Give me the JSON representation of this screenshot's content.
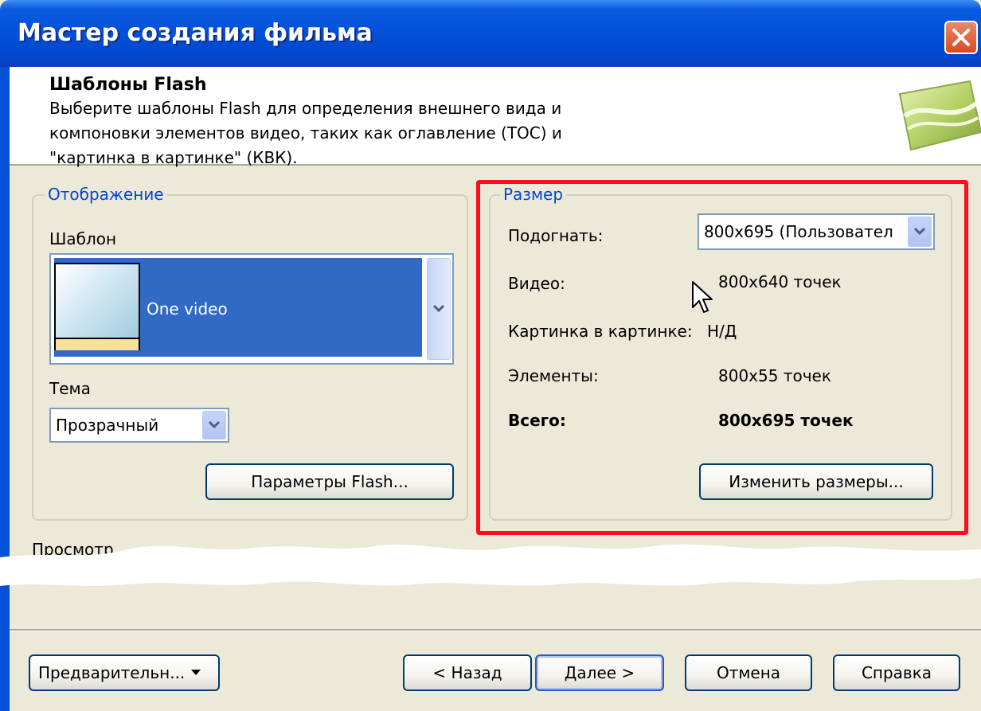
{
  "window": {
    "title": "Мастер создания фильма"
  },
  "header": {
    "title": "Шаблоны Flash",
    "description": "Выберите шаблоны Flash для определения внешнего вида и\nкомпоновки элементов видео, таких как оглавление (TOC) и\n\"картинка в картинке\" (КВК)."
  },
  "display_group": {
    "legend": "Отображение",
    "template_label": "Шаблон",
    "template_selected": "One video",
    "theme_label": "Тема",
    "theme_value": "Прозрачный",
    "flash_params_button": "Параметры Flash..."
  },
  "size_group": {
    "legend": "Размер",
    "fit_label": "Подогнать:",
    "fit_value": "800x695 (Пользовател",
    "video_label": "Видео:",
    "video_value": "800x640 точек",
    "pip_label": "Картинка в картинке:",
    "pip_value": "Н/Д",
    "elements_label": "Элементы:",
    "elements_value": "800x55 точек",
    "total_label": "Всего:",
    "total_value": "800x695 точек",
    "resize_button": "Изменить размеры..."
  },
  "preview_label": "Просмотр",
  "footer": {
    "preview_dropdown": "Предварительн...",
    "back_button": "< Назад",
    "next_button": "Далее >",
    "cancel_button": "Отмена",
    "help_button": "Справка"
  },
  "colors": {
    "titlebar": "#0450d8",
    "highlight": "#ff0d1f",
    "selection": "#316ac5",
    "dialog_bg": "#ece9d8"
  }
}
